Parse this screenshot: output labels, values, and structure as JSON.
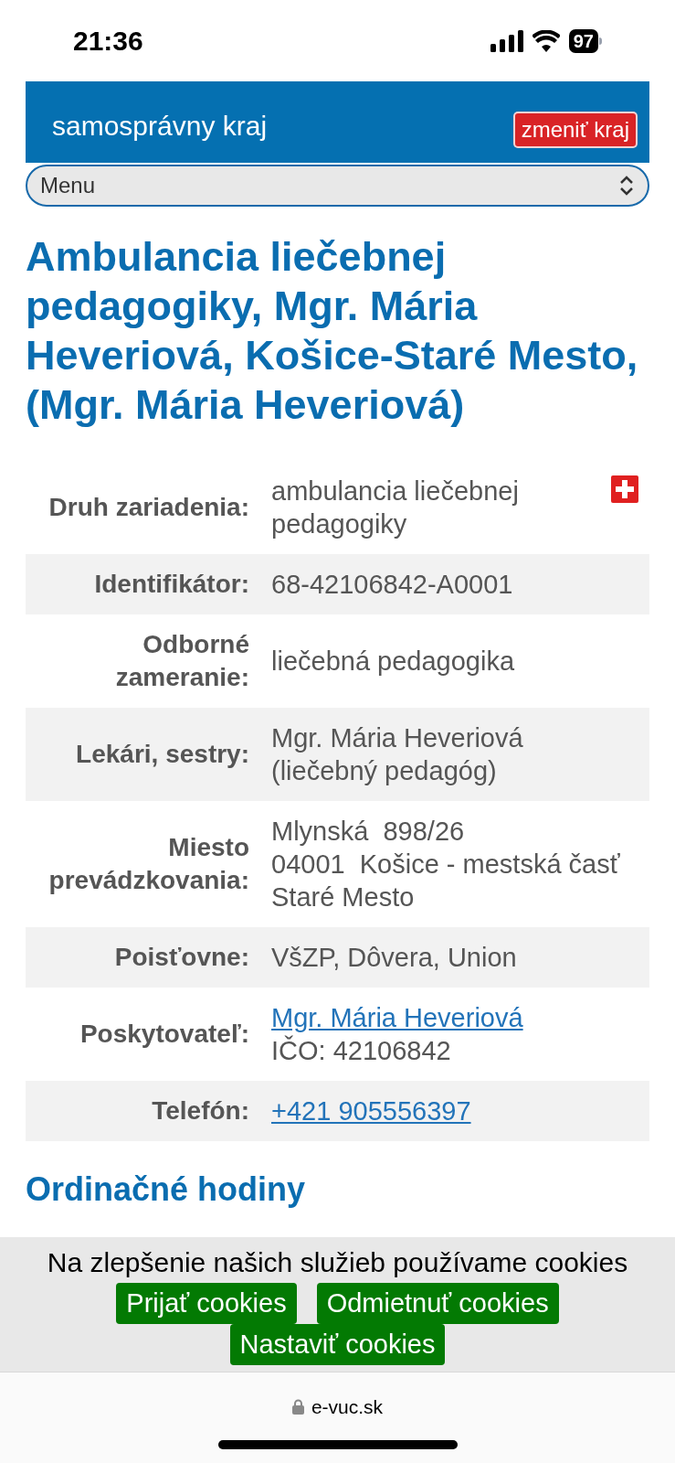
{
  "status_bar": {
    "time": "21:36",
    "battery": "97"
  },
  "header": {
    "subtitle": "samosprávny kraj",
    "change_button": "zmeniť kraj"
  },
  "menu_select": {
    "value": "Menu"
  },
  "title": "Ambulancia liečebnej pedagogiky, Mgr. Mária Heveriová, Košice-Staré Mesto, (Mgr. Mária Heveriová)",
  "details": [
    {
      "label": "Druh zariadenia:",
      "lines": [
        {
          "kind": "text",
          "text": "ambulancia liečebnej pedagogiky"
        }
      ],
      "medical_icon": true
    },
    {
      "label": "Identifikátor:",
      "lines": [
        {
          "kind": "text",
          "text": "68-42106842-A0001"
        }
      ],
      "medical_icon": false
    },
    {
      "label": "Odborné zameranie:",
      "lines": [
        {
          "kind": "text",
          "text": "liečebná pedagogika"
        }
      ],
      "medical_icon": false
    },
    {
      "label": "Lekári, sestry:",
      "lines": [
        {
          "kind": "text",
          "text": "Mgr. Mária Heveriová"
        },
        {
          "kind": "text",
          "text": "(liečebný pedagóg)"
        }
      ],
      "medical_icon": false
    },
    {
      "label": "Miesto prevádzkovania:",
      "lines": [
        {
          "kind": "text",
          "text": "Mlynská  898/26"
        },
        {
          "kind": "text",
          "text": "04001  Košice - mestská časť Staré Mesto"
        }
      ],
      "medical_icon": false
    },
    {
      "label": "Poisťovne:",
      "lines": [
        {
          "kind": "text",
          "text": "VšZP, Dôvera, Union"
        }
      ],
      "medical_icon": false
    },
    {
      "label": "Poskytovateľ:",
      "lines": [
        {
          "kind": "link",
          "text": "Mgr. Mária Heveriová"
        },
        {
          "kind": "text",
          "text": "IČO: 42106842"
        }
      ],
      "medical_icon": false
    },
    {
      "label": "Telefón:",
      "lines": [
        {
          "kind": "link",
          "text": "+421 905556397"
        }
      ],
      "medical_icon": false
    }
  ],
  "hours": {
    "heading": "Ordinačné hodiny"
  },
  "cookie_banner": {
    "message": "Na zlepšenie našich služieb používame cookies",
    "buttons": [
      "Prijať cookies",
      "Odmietnuť cookies",
      "Nastaviť cookies"
    ]
  },
  "address_bar": {
    "url": "e-vuc.sk"
  }
}
